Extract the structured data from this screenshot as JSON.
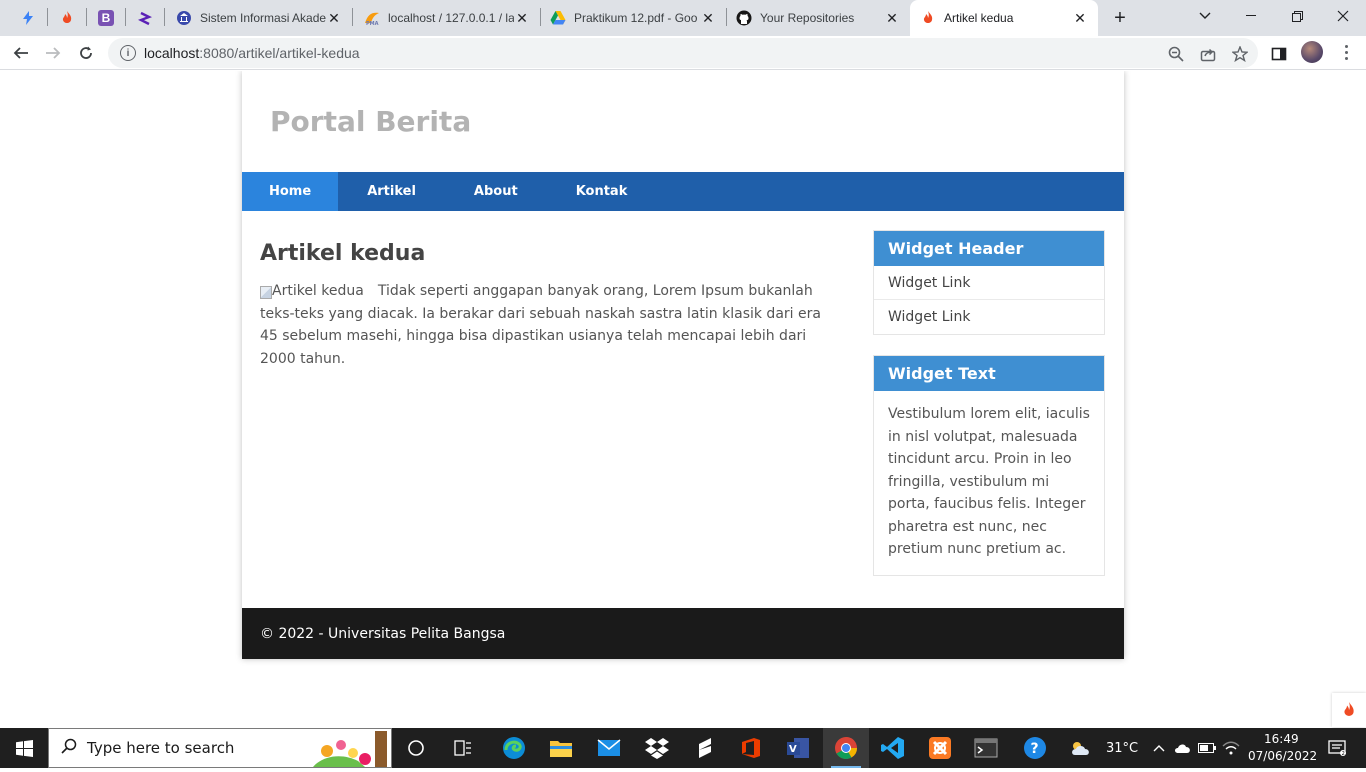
{
  "browser": {
    "tabs": [
      {
        "title": "Sistem Informasi Akade",
        "favicon": "university-icon"
      },
      {
        "title": "localhost / 127.0.0.1 / la",
        "favicon": "phpmyadmin-icon"
      },
      {
        "title": "Praktikum 12.pdf - Goo",
        "favicon": "google-drive-icon"
      },
      {
        "title": "Your Repositories",
        "favicon": "github-icon"
      },
      {
        "title": "Artikel kedua",
        "favicon": "codeigniter-icon",
        "active": true
      }
    ],
    "url": {
      "host": "localhost",
      "path": ":8080/artikel/artikel-kedua"
    }
  },
  "site": {
    "title": "Portal Berita",
    "nav": [
      "Home",
      "Artikel",
      "About",
      "Kontak"
    ],
    "active_nav": "Home",
    "colors": {
      "nav": "#1f5faa",
      "nav_active": "#2b84dd",
      "widget_header": "#3f8fd2",
      "footer": "#1a1a1a"
    }
  },
  "article": {
    "title": "Artikel kedua",
    "image_alt": "Artikel kedua",
    "body": "Tidak seperti anggapan banyak orang, Lorem Ipsum bukanlah teks-teks yang diacak. Ia berakar dari sebuah naskah sastra latin klasik dari era 45 sebelum masehi, hingga bisa dipastikan usianya telah mencapai lebih dari 2000 tahun."
  },
  "sidebar": {
    "widget1": {
      "header": "Widget Header",
      "links": [
        "Widget Link",
        "Widget Link"
      ]
    },
    "widget2": {
      "header": "Widget Text",
      "text": "Vestibulum lorem elit, iaculis in nisl volutpat, malesuada tincidunt arcu. Proin in leo fringilla, vestibulum mi porta, faucibus felis. Integer pharetra est nunc, nec pretium nunc pretium ac."
    }
  },
  "footer": {
    "text": "© 2022 - Universitas Pelita Bangsa"
  },
  "taskbar": {
    "search_placeholder": "Type here to search",
    "temperature": "31°C",
    "time": "16:49",
    "date": "07/06/2022"
  }
}
